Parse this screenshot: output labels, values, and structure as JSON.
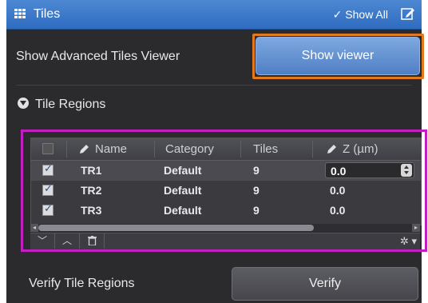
{
  "titlebar": {
    "title": "Tiles",
    "show_all": "Show All"
  },
  "advanced": {
    "label": "Show Advanced Tiles Viewer",
    "button": "Show viewer"
  },
  "section": {
    "title": "Tile Regions"
  },
  "table": {
    "headers": {
      "name": "Name",
      "category": "Category",
      "tiles": "Tiles",
      "z": "Z (µm)"
    },
    "rows": [
      {
        "name": "TR1",
        "category": "Default",
        "tiles": "9",
        "z": "0.0",
        "checked": true
      },
      {
        "name": "TR2",
        "category": "Default",
        "tiles": "9",
        "z": "0.0",
        "checked": true
      },
      {
        "name": "TR3",
        "category": "Default",
        "tiles": "9",
        "z": "0.0",
        "checked": true
      }
    ]
  },
  "verify": {
    "label": "Verify Tile Regions",
    "button": "Verify"
  },
  "colors": {
    "title_bar": "#3a77c8",
    "panel_bg": "#2b2b2e",
    "highlight_orange": "#e07a1e",
    "highlight_magenta": "#c21fc2"
  }
}
